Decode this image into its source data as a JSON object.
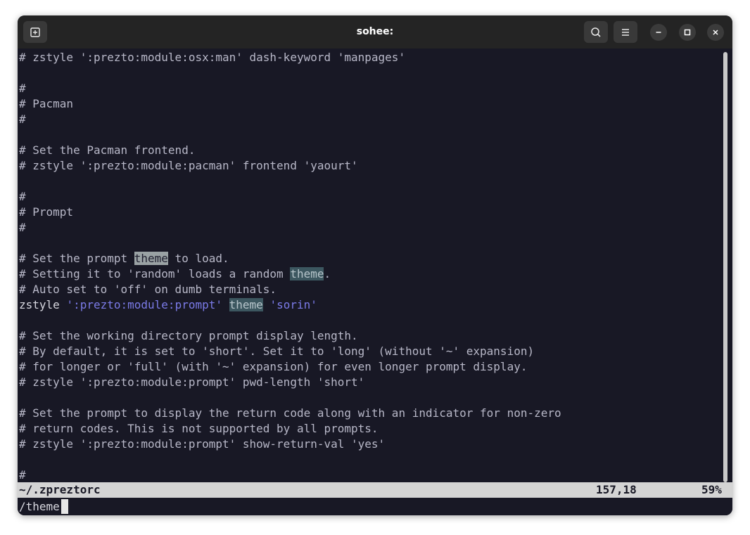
{
  "window": {
    "title": "sohee:"
  },
  "titlebar": {
    "new_tab_icon": "new-tab-icon",
    "search_icon": "search-icon",
    "menu_icon": "hamburger-menu-icon",
    "minimize_icon": "minimize-icon",
    "maximize_icon": "maximize-icon",
    "close_icon": "close-icon"
  },
  "editor": {
    "lines": [
      "# zstyle ':prezto:module:osx:man' dash-keyword 'manpages'",
      "",
      "#",
      "# Pacman",
      "#",
      "",
      "# Set the Pacman frontend.",
      "# zstyle ':prezto:module:pacman' frontend 'yaourt'",
      "",
      "#",
      "# Prompt",
      "#",
      "",
      "",
      "",
      "",
      "",
      "",
      "# Set the working directory prompt display length.",
      "# By default, it is set to 'short'. Set it to 'long' (without '~' expansion)",
      "# for longer or 'full' (with '~' expansion) for even longer prompt display.",
      "# zstyle ':prezto:module:prompt' pwd-length 'short'",
      "",
      "# Set the prompt to display the return code along with an indicator for non-zero",
      "# return codes. This is not supported by all prompts.",
      "# zstyle ':prezto:module:prompt' show-return-val 'yes'",
      "",
      "",
      "#"
    ],
    "rich": {
      "l13_pre": "# Set the prompt ",
      "l13_match": "theme",
      "l13_post": " to load.",
      "l14_pre": "# Setting it to 'random' loads a random ",
      "l14_match": "theme",
      "l14_post": ".",
      "l15": "# Auto set to 'off' on dumb terminals.",
      "l16_cmd": "zstyle ",
      "l16_str1": "':prezto:module:prompt'",
      "l16_match": "theme",
      "l16_str2": "'sorin'"
    }
  },
  "statusbar": {
    "file": "~/.zpreztorc",
    "position": "157,18",
    "percent": "59%"
  },
  "cmdline": {
    "text": "/theme"
  },
  "colors": {
    "terminal_bg": "#181825",
    "titlebar_bg": "#242424",
    "comment_fg": "#b8b8c8",
    "string_fg": "#7b7be8",
    "current_match_bg": "#9aa2a4",
    "other_match_bg": "#3c5760",
    "statusbar_bg": "#d4d4d4"
  }
}
